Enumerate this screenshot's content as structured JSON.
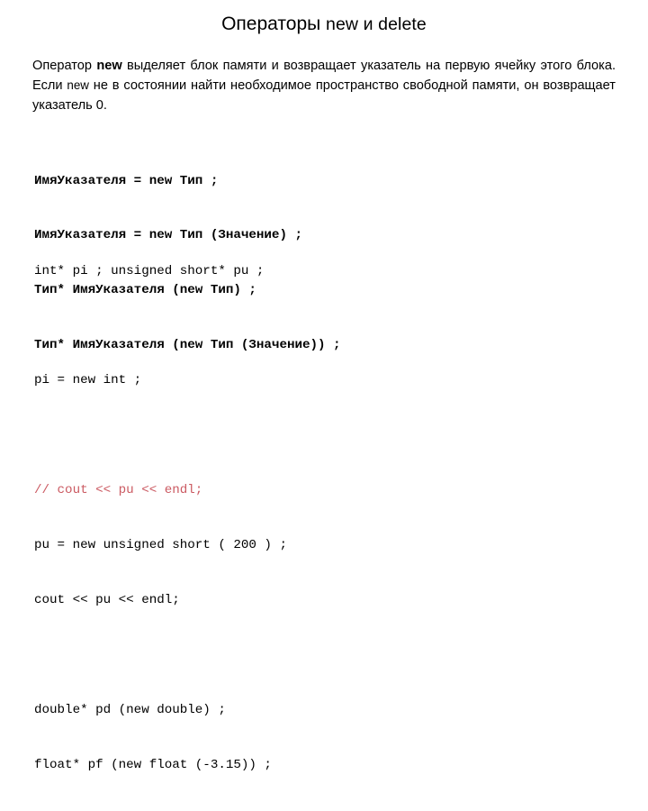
{
  "slide": {
    "background_color": "#ffffff",
    "text_color": "#000000",
    "comment_color": "#cb5a62"
  },
  "title": {
    "cyrillic_part": "Операторы ",
    "latin_part": "new и delete",
    "full": "Операторы new и delete"
  },
  "paragraph": {
    "seg1": "Оператор ",
    "seg2_bold": "new",
    "seg3": " выделяет блок памяти и возвращает указатель на первую ячейку этого блока. Если ",
    "seg4_kw": "new",
    "seg5": " не в состоянии найти необходимое пространство свободной памяти, он возвращает указатель 0.",
    "full": "Оператор new выделяет блок памяти и возвращает указатель на первую ячейку этого блока. Если new не в состоянии найти необходимое пространство свободной памяти, он возвращает указатель 0."
  },
  "syntax_block": {
    "style": "bold-monospace",
    "lines": [
      "ИмяУказателя = new Тип ;",
      "ИмяУказателя = new Тип (Значение) ;",
      "Тип* ИмяУказателя (new Тип) ;",
      "Тип* ИмяУказателя (new Тип (Значение)) ;"
    ]
  },
  "example_block": {
    "style": "regular-monospace",
    "lines": [
      {
        "text": "int* pi ; unsigned short* pu ;",
        "comment": false
      },
      {
        "text": "",
        "comment": false
      },
      {
        "text": "pi = new int ;",
        "comment": false
      },
      {
        "text": "",
        "comment": false
      },
      {
        "text": "// cout << pu << endl;",
        "comment": true
      },
      {
        "text": "pu = new unsigned short ( 200 ) ;",
        "comment": false
      },
      {
        "text": "cout << pu << endl;",
        "comment": false
      },
      {
        "text": "",
        "comment": false
      },
      {
        "text": "double* pd (new double) ;",
        "comment": false
      },
      {
        "text": "float* pf (new float (-3.15)) ;",
        "comment": false
      }
    ]
  }
}
